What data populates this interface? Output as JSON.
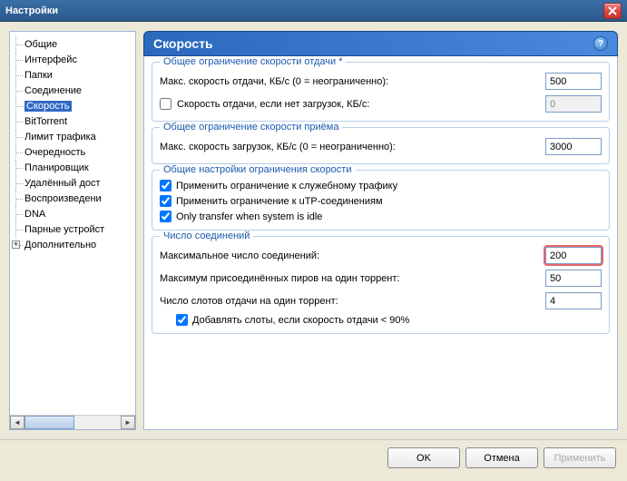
{
  "window": {
    "title": "Настройки"
  },
  "sidebar": {
    "items": [
      {
        "label": "Общие"
      },
      {
        "label": "Интерфейс"
      },
      {
        "label": "Папки"
      },
      {
        "label": "Соединение"
      },
      {
        "label": "Скорость",
        "selected": true
      },
      {
        "label": "BitTorrent"
      },
      {
        "label": "Лимит трафика"
      },
      {
        "label": "Очередность"
      },
      {
        "label": "Планировщик"
      },
      {
        "label": "Удалённый дост"
      },
      {
        "label": "Воспроизведени"
      },
      {
        "label": "DNA"
      },
      {
        "label": "Парные устройст"
      },
      {
        "label": "Дополнительно",
        "expandable": true
      }
    ]
  },
  "panel": {
    "title": "Скорость"
  },
  "groups": {
    "upload": {
      "title": "Общее ограничение скорости отдачи *",
      "max_label": "Макс. скорость отдачи, КБ/с (0 = неограниченно):",
      "max_value": "500",
      "alt_label": "Скорость отдачи, если нет загрузок, КБ/с:",
      "alt_value": "0",
      "alt_checked": false
    },
    "download": {
      "title": "Общее ограничение скорости приёма",
      "max_label": "Макс. скорость загрузок, КБ/с (0 = неограниченно):",
      "max_value": "3000"
    },
    "common": {
      "title": "Общие настройки ограничения скорости",
      "opt1": "Применить ограничение к служебному трафику",
      "opt2": "Применить ограничение к uTP-соединениям",
      "opt3": "Only transfer when system is idle"
    },
    "conn": {
      "title": "Число соединений",
      "l1": "Максимальное число соединений:",
      "v1": "200",
      "l2": "Максимум присоединённых пиров на один торрент:",
      "v2": "50",
      "l3": "Число слотов отдачи на один торрент:",
      "v3": "4",
      "opt": "Добавлять слоты, если скорость отдачи < 90%"
    }
  },
  "buttons": {
    "ok": "OK",
    "cancel": "Отмена",
    "apply": "Применить"
  }
}
